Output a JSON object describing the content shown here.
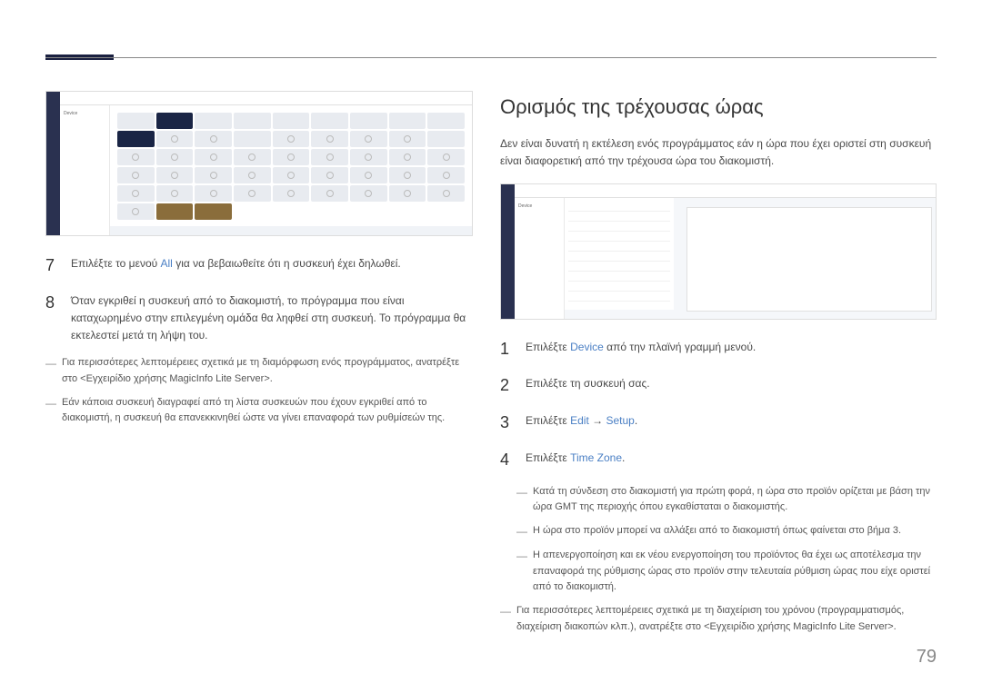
{
  "page_number": "79",
  "left": {
    "step7": {
      "intro": "Επιλέξτε το μενού ",
      "link": "All",
      "rest": " για να βεβαιωθείτε ότι η συσκευή έχει δηλωθεί."
    },
    "step8": "Όταν εγκριθεί η συσκευή από το διακομιστή, το πρόγραμμα που είναι καταχωρημένο στην επιλεγμένη ομάδα θα ληφθεί στη συσκευή. Το πρόγραμμα θα εκτελεστεί μετά τη λήψη του.",
    "note1": "Για περισσότερες λεπτομέρειες σχετικά με τη διαμόρφωση ενός προγράμματος, ανατρέξτε στο <Εγχειρίδιο χρήσης MagicInfo Lite Server>.",
    "note2": "Εάν κάποια συσκευή διαγραφεί από τη λίστα συσκευών που έχουν εγκριθεί από το διακομιστή, η συσκευή θα επανεκκινηθεί ώστε να γίνει επαναφορά των ρυθμίσεών της."
  },
  "right": {
    "heading": "Ορισμός της τρέχουσας ώρας",
    "intro": "Δεν είναι δυνατή η εκτέλεση ενός προγράμματος εάν η ώρα που έχει οριστεί στη συσκευή είναι διαφορετική από την τρέχουσα ώρα του διακομιστή.",
    "step1": {
      "intro": "Επιλέξτε ",
      "link": "Device",
      "rest": " από την πλαϊνή γραμμή μενού."
    },
    "step2": "Επιλέξτε τη συσκευή σας.",
    "step3": {
      "intro": "Επιλέξτε ",
      "link1": "Edit",
      "arrow": " → ",
      "link2": "Setup",
      "end": "."
    },
    "step4": {
      "intro": "Επιλέξτε ",
      "link": "Time Zone",
      "end": "."
    },
    "note1": "Κατά τη σύνδεση στο διακομιστή για πρώτη φορά, η ώρα στο προϊόν ορίζεται με βάση την ώρα GMT της περιοχής όπου εγκαθίσταται ο διακομιστής.",
    "note2": "Η ώρα στο προϊόν μπορεί να αλλάξει από το διακομιστή όπως φαίνεται στο βήμα 3.",
    "note3": "Η απενεργοποίηση και εκ νέου ενεργοποίηση του προϊόντος θα έχει ως αποτέλεσμα την επαναφορά της ρύθμισης ώρας στο προϊόν στην τελευταία ρύθμιση ώρας που είχε οριστεί από το διακομιστή.",
    "note4": "Για περισσότερες λεπτομέρειες σχετικά με τη διαχείριση του χρόνου (προγραμματισμός, διαχείριση διακοπών κλπ.), ανατρέξτε στο <Εγχειρίδιο χρήσης MagicInfo Lite Server>."
  },
  "screenshot_left": {
    "title": "Device"
  },
  "screenshot_right": {
    "title": "Device"
  }
}
